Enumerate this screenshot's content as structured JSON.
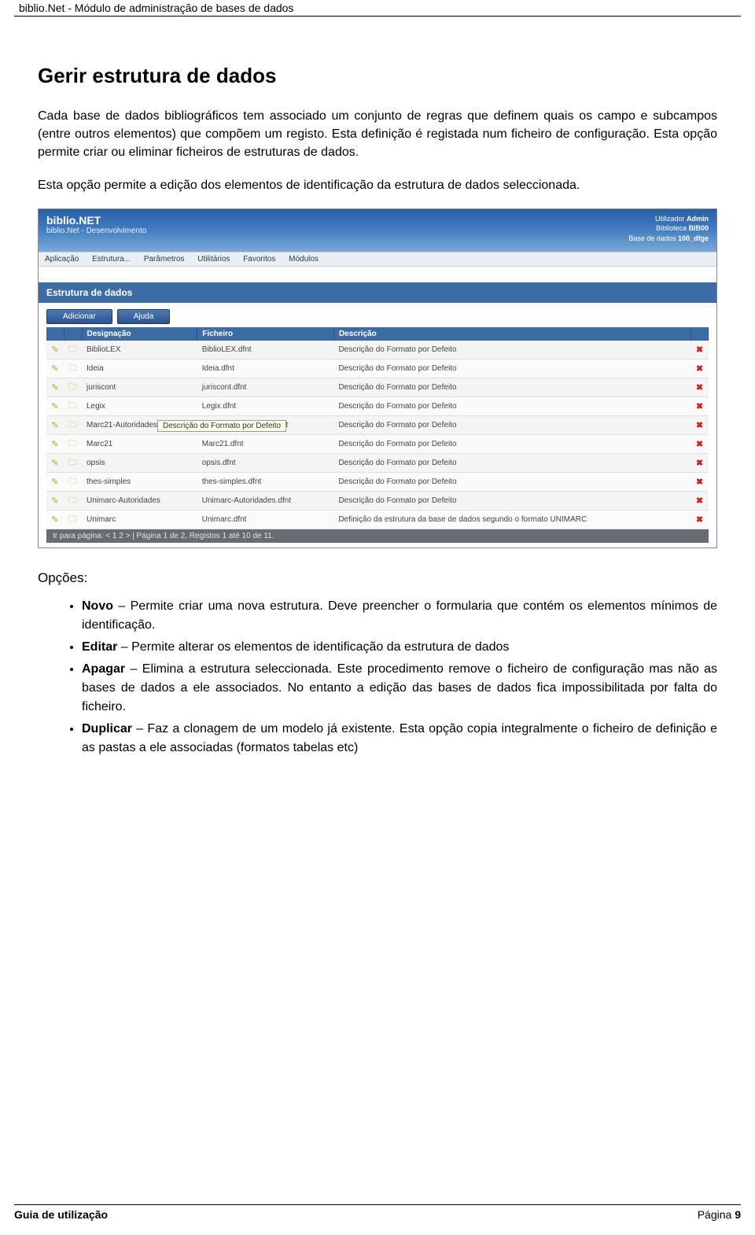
{
  "header": {
    "text": "biblio.Net - Módulo de administração de bases de dados"
  },
  "section_title": "Gerir estrutura de dados",
  "paragraph1": "Cada base de dados bibliográficos tem associado um conjunto de regras que definem quais os campo e subcampos (entre outros elementos) que compõem um registo. Esta definição é registada num ficheiro de configuração. Esta opção permite criar ou eliminar ficheiros de estruturas de dados.",
  "paragraph2": "Esta opção permite a edição dos elementos de identificação da estrutura de dados seleccionada.",
  "app": {
    "brand": "biblio.NET",
    "subtitle": "biblio.Net - Desenvolvimento",
    "user_label": "Utilizador",
    "user_value": "Admin",
    "lib_label": "Biblioteca",
    "lib_value": "BIB00",
    "db_label": "Base de dados",
    "db_value": "100_dfge",
    "menu": [
      "Aplicação",
      "Estrutura...",
      "Parâmetros",
      "Utilitários",
      "Favoritos",
      "Módulos"
    ],
    "section_bar": "Estrutura de dados",
    "toolbar": {
      "add": "Adicionar",
      "help": "Ajuda"
    },
    "columns": {
      "c1": "Designação",
      "c2": "Ficheiro",
      "c3": "Descrição"
    },
    "rows": [
      {
        "name": "BiblioLEX",
        "file": "BiblioLEX.dfnt",
        "desc": "Descrição do Formato por Defeito"
      },
      {
        "name": "Ideia",
        "file": "Ideia.dfnt",
        "desc": "Descrição do Formato por Defeito"
      },
      {
        "name": "juriscont",
        "file": "juriscont.dfnt",
        "desc": "Descrição do Formato por Defeito"
      },
      {
        "name": "Legix",
        "file": "Legix.dfnt",
        "desc": "Descrição do Formato por Defeito"
      },
      {
        "name": "Marc21-Autoridades",
        "file": "Marc21-Autoridades.dfnt",
        "desc": "Descrição do Formato por Defeito"
      },
      {
        "name": "Marc21",
        "file": "Marc21.dfnt",
        "desc": "Descrição do Formato por Defeito"
      },
      {
        "name": "opsis",
        "file": "opsis.dfnt",
        "desc": "Descrição do Formato por Defeito"
      },
      {
        "name": "thes-simples",
        "file": "thes-simples.dfnt",
        "desc": "Descrição do Formato por Defeito"
      },
      {
        "name": "Unimarc-Autoridades",
        "file": "Unimarc-Autoridades.dfnt",
        "desc": "Descrição do Formato por Defeito"
      },
      {
        "name": "Unimarc",
        "file": "Unimarc.dfnt",
        "desc": "Definição da estrutura da base de dados segundo o formato UNIMARC"
      }
    ],
    "tooltip": "Descrição do Formato por Defeito",
    "pager": "Ir para página: < 1 2 >  | Página 1 de 2, Registos 1 até 10 de 11."
  },
  "options": {
    "title": "Opções:",
    "items": [
      {
        "term": "Novo",
        "sep": " – ",
        "rest": "Permite criar uma nova estrutura. Deve preencher o formularia que contém os elementos mínimos de identificação."
      },
      {
        "term": "Editar",
        "sep": " – ",
        "rest": "Permite alterar os elementos de identificação da estrutura de dados"
      },
      {
        "term": "Apagar",
        "sep": " – ",
        "rest": "Elimina a estrutura seleccionada. Este procedimento remove o ficheiro de configuração mas não as bases de dados a ele associados. No entanto a edição das bases de dados fica impossibilitada por falta do ficheiro."
      },
      {
        "term": "Duplicar",
        "sep": " – ",
        "rest": "Faz a clonagem de um modelo já existente. Esta opção copia integralmente o ficheiro de definição e as pastas a ele associadas (formatos tabelas etc)"
      }
    ]
  },
  "footer": {
    "left": "Guia de utilização",
    "right_label": "Página ",
    "right_num": "9"
  }
}
